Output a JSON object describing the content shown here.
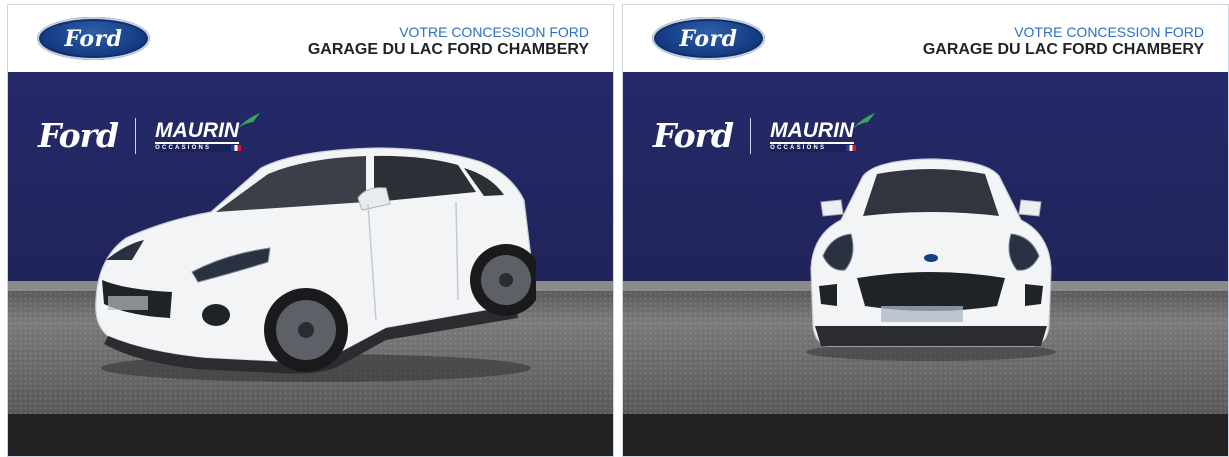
{
  "panels": [
    {
      "id": "panel-1",
      "view": "three-quarter front",
      "header": {
        "logo_text": "Ford",
        "dealer_line1": "VOTRE CONCESSION FORD",
        "dealer_line2": "GARAGE DU LAC FORD CHAMBERY"
      },
      "brand": {
        "ford_script": "Ford",
        "maurin": "MAURIN",
        "maurin_sub": "OCCASIONS"
      }
    },
    {
      "id": "panel-2",
      "view": "front",
      "header": {
        "logo_text": "Ford",
        "dealer_line1": "VOTRE CONCESSION FORD",
        "dealer_line2": "GARAGE DU LAC FORD CHAMBERY"
      },
      "brand": {
        "ford_script": "Ford",
        "maurin": "MAURIN",
        "maurin_sub": "OCCASIONS"
      }
    }
  ],
  "colors": {
    "backdrop_navy": "#232760",
    "ford_blue": "#163f86",
    "dealer_blue": "#2d6ec7",
    "maurin_green": "#3aa655",
    "car_white": "#f2f4f6"
  }
}
